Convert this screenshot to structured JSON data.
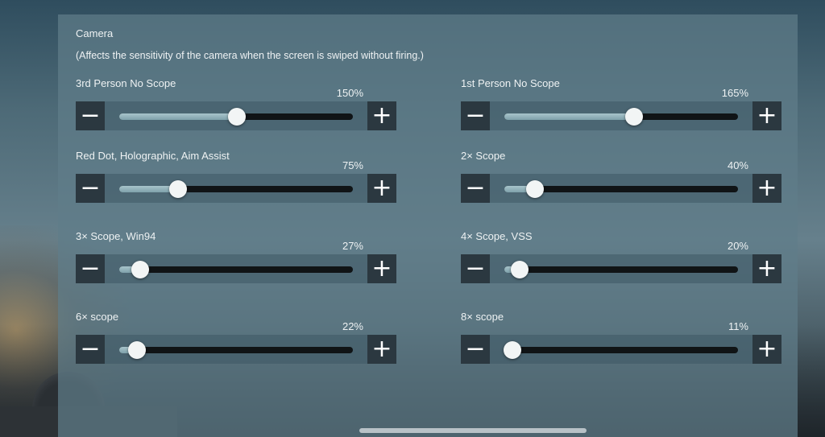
{
  "camera": {
    "title": "Camera",
    "description": "(Affects the sensitivity of the camera when the screen is swiped without firing.)",
    "controls": [
      {
        "label": "3rd Person No Scope",
        "value_text": "150%",
        "level": 0.505
      },
      {
        "label": "1st Person No Scope",
        "value_text": "165%",
        "level": 0.555
      },
      {
        "label": "Red Dot, Holographic, Aim Assist",
        "value_text": "75%",
        "level": 0.25
      },
      {
        "label": "2× Scope",
        "value_text": "40%",
        "level": 0.13
      },
      {
        "label": "3× Scope, Win94",
        "value_text": "27%",
        "level": 0.09
      },
      {
        "label": "4× Scope, VSS",
        "value_text": "20%",
        "level": 0.065
      },
      {
        "label": "6× scope",
        "value_text": "22%",
        "level": 0.075
      },
      {
        "label": "8× scope",
        "value_text": "11%",
        "level": 0.035
      }
    ]
  },
  "buttons": {
    "minus": "−",
    "plus": "+"
  },
  "icons": {
    "minus": "minus-icon",
    "plus": "plus-icon"
  }
}
